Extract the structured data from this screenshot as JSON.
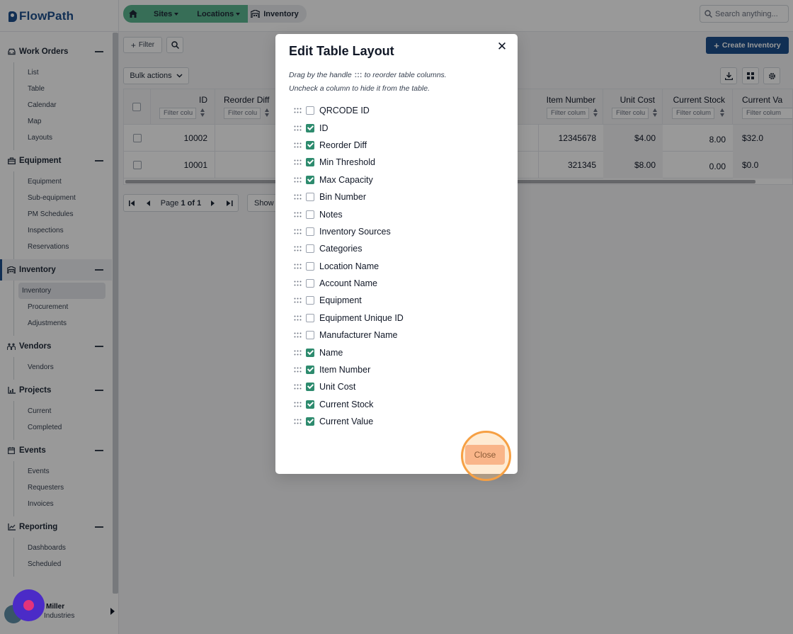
{
  "app": {
    "logo_text": "FlowPath"
  },
  "sidebar": {
    "groups": [
      {
        "label": "Work Orders",
        "icon": "car-icon",
        "items": [
          "List",
          "Table",
          "Calendar",
          "Map",
          "Layouts"
        ]
      },
      {
        "label": "Equipment",
        "icon": "toolbox-icon",
        "items": [
          "Equipment",
          "Sub-equipment",
          "PM Schedules",
          "Inspections",
          "Reservations"
        ]
      },
      {
        "label": "Inventory",
        "icon": "warehouse-icon",
        "items": [
          "Inventory",
          "Procurement",
          "Adjustments"
        ],
        "active": true,
        "selected_item": "Inventory"
      },
      {
        "label": "Vendors",
        "icon": "people-icon",
        "items": [
          "Vendors"
        ]
      },
      {
        "label": "Projects",
        "icon": "chart-icon",
        "items": [
          "Current",
          "Completed"
        ]
      },
      {
        "label": "Events",
        "icon": "calendar-icon",
        "items": [
          "Events",
          "Requesters",
          "Invoices"
        ]
      },
      {
        "label": "Reporting",
        "icon": "line-chart-icon",
        "items": [
          "Dashboards",
          "Scheduled"
        ]
      }
    ],
    "user": {
      "name": "Miller",
      "org": "Industries"
    }
  },
  "topbar": {
    "breadcrumbs": [
      "Sites",
      "Locations",
      "Inventory"
    ],
    "search_placeholder": "Search anything..."
  },
  "toolbar": {
    "filter_label": "Filter",
    "create_label": "Create Inventory",
    "bulk_label": "Bulk actions"
  },
  "table": {
    "columns": [
      "ID",
      "Reorder Diff",
      "Item Number",
      "Unit Cost",
      "Current Stock",
      "Current Va"
    ],
    "filter_placeholder": "Filter colu",
    "filter_placeholder_wide": "Filter colum",
    "rows": [
      {
        "id": "10002",
        "item_number": "12345678",
        "unit_cost": "$4.00",
        "current_stock": "8.00",
        "current_value": "$32.0"
      },
      {
        "id": "10001",
        "item_number": "321345",
        "unit_cost": "$8.00",
        "current_stock": "0.00",
        "current_value": "$0.0"
      }
    ]
  },
  "pagination": {
    "prefix": "Page",
    "current": "1",
    "of": "of",
    "total": "1",
    "show_label": "Show"
  },
  "modal": {
    "title": "Edit Table Layout",
    "hint_line1_a": "Drag by the handle",
    "hint_line1_b": "to reorder table columns.",
    "hint_line2": "Uncheck a column to hide it from the table.",
    "close_label": "Close",
    "columns": [
      {
        "label": "QRCODE ID",
        "checked": false
      },
      {
        "label": "ID",
        "checked": true
      },
      {
        "label": "Reorder Diff",
        "checked": true
      },
      {
        "label": "Min Threshold",
        "checked": true
      },
      {
        "label": "Max Capacity",
        "checked": true
      },
      {
        "label": "Bin Number",
        "checked": false
      },
      {
        "label": "Notes",
        "checked": false
      },
      {
        "label": "Inventory Sources",
        "checked": false
      },
      {
        "label": "Categories",
        "checked": false
      },
      {
        "label": "Location Name",
        "checked": false
      },
      {
        "label": "Account Name",
        "checked": false
      },
      {
        "label": "Equipment",
        "checked": false
      },
      {
        "label": "Equipment Unique ID",
        "checked": false
      },
      {
        "label": "Manufacturer Name",
        "checked": false
      },
      {
        "label": "Name",
        "checked": true
      },
      {
        "label": "Item Number",
        "checked": true
      },
      {
        "label": "Unit Cost",
        "checked": true
      },
      {
        "label": "Current Stock",
        "checked": true
      },
      {
        "label": "Current Value",
        "checked": true
      }
    ]
  },
  "colors": {
    "brand": "#1d4f8c",
    "checkbox_on": "#2e8b6e",
    "breadcrumb_green": "#5db892",
    "close_button": "#f7ad8e",
    "focus_ring": "#f6a044",
    "help_bubble": "#4b2bc7"
  }
}
